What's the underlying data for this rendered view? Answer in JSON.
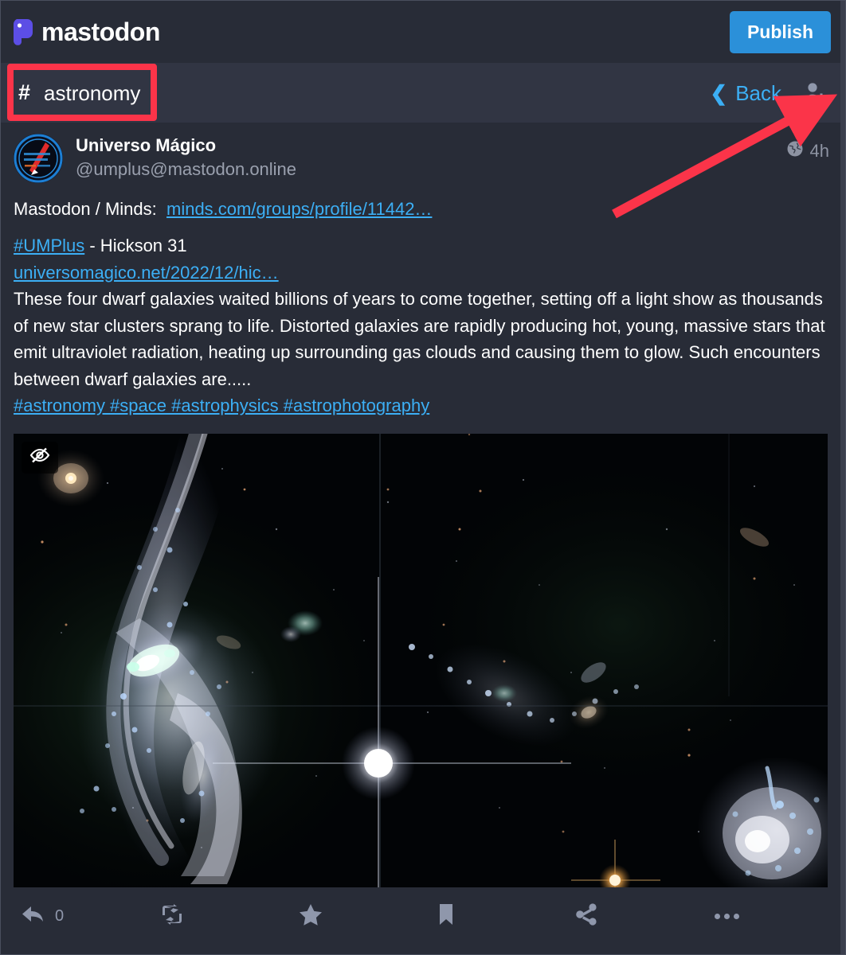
{
  "app": {
    "brand_name": "mastodon",
    "brand_color": "#5c4ee5"
  },
  "topbar": {
    "publish_label": "Publish",
    "publish_color": "#2b90d9"
  },
  "navbar": {
    "hash_symbol": "#",
    "tag_name": "astronomy",
    "back_label": "Back",
    "back_chevron": "❮",
    "back_color": "#3caff5",
    "add_person_icon": "person-add-icon"
  },
  "post": {
    "display_name": "Universo Mágico",
    "handle": "@umplus@mastodon.online",
    "visibility_icon": "globe-icon",
    "timestamp": "4h",
    "lines": {
      "intro_label": "Mastodon / Minds:",
      "intro_link": "minds.com/groups/profile/11442…",
      "tag_umplus": "#UMPlus",
      "title_rest": " - Hickson 31",
      "source_link": "universomagico.net/2022/12/hic…",
      "paragraph": "These four dwarf galaxies waited billions of years to come together, setting off a light show as thousands of new star clusters sprang to life. Distorted galaxies are rapidly producing hot, young, massive stars that emit ultraviolet radiation, heating up surrounding gas clouds and causing them to glow. Such encounters between dwarf galaxies are.....",
      "hashtags": "#astronomy #space #astrophysics #astrophotography"
    },
    "media": {
      "hide_media_icon": "eye-slash-icon",
      "alt": "Hubble image of interacting dwarf galaxies Hickson Compact Group 31"
    }
  },
  "actions": [
    {
      "name": "reply",
      "icon": "reply-icon",
      "count": "0"
    },
    {
      "name": "boost",
      "icon": "boost-icon",
      "count": ""
    },
    {
      "name": "favourite",
      "icon": "star-icon",
      "count": ""
    },
    {
      "name": "bookmark",
      "icon": "bookmark-icon",
      "count": ""
    },
    {
      "name": "share",
      "icon": "share-icon",
      "count": ""
    },
    {
      "name": "more",
      "icon": "ellipsis-icon",
      "count": ""
    }
  ],
  "annotations": {
    "highlight_color": "#fb3449",
    "arrow_color": "#fb3449",
    "highlight_target": "hashtag-title",
    "arrow_target": "person-add-icon"
  }
}
